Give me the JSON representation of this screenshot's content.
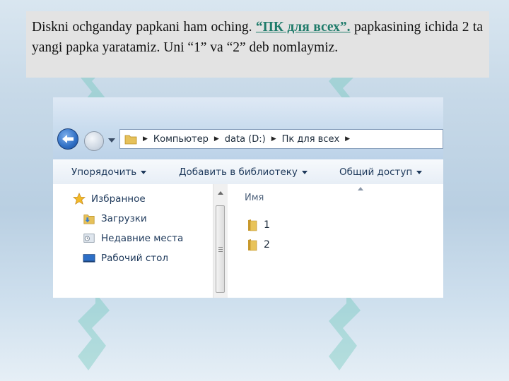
{
  "slide": {
    "text_part1": "Diskni ochganday papkani ham oching. ",
    "text_highlight": "“ПК для всех”.",
    "text_part2": " papkasining ichida 2 ta yangi papka yaratamiz. Uni “1” va “2” deb nomlaymiz."
  },
  "explorer": {
    "breadcrumb": [
      "Компьютер",
      "data (D:)",
      "Пк для всех"
    ],
    "toolbar": {
      "organize_label": "Упорядочить",
      "library_label": "Добавить в библиотеку",
      "share_label": "Общий доступ"
    },
    "nav": {
      "favorites_label": "Избранное",
      "items": [
        {
          "label": "Загрузки",
          "icon": "downloads-icon"
        },
        {
          "label": "Недавние места",
          "icon": "recent-places-icon"
        },
        {
          "label": "Рабочий стол",
          "icon": "desktop-icon"
        }
      ]
    },
    "content": {
      "column_name": "Имя",
      "files": [
        {
          "name": "1",
          "icon": "folder-icon"
        },
        {
          "name": "2",
          "icon": "folder-icon"
        }
      ]
    }
  },
  "colors": {
    "highlight_text": "#1f7b6a",
    "text_box_bg": "#e3e3e3",
    "watermark": "#5fc4b4"
  }
}
